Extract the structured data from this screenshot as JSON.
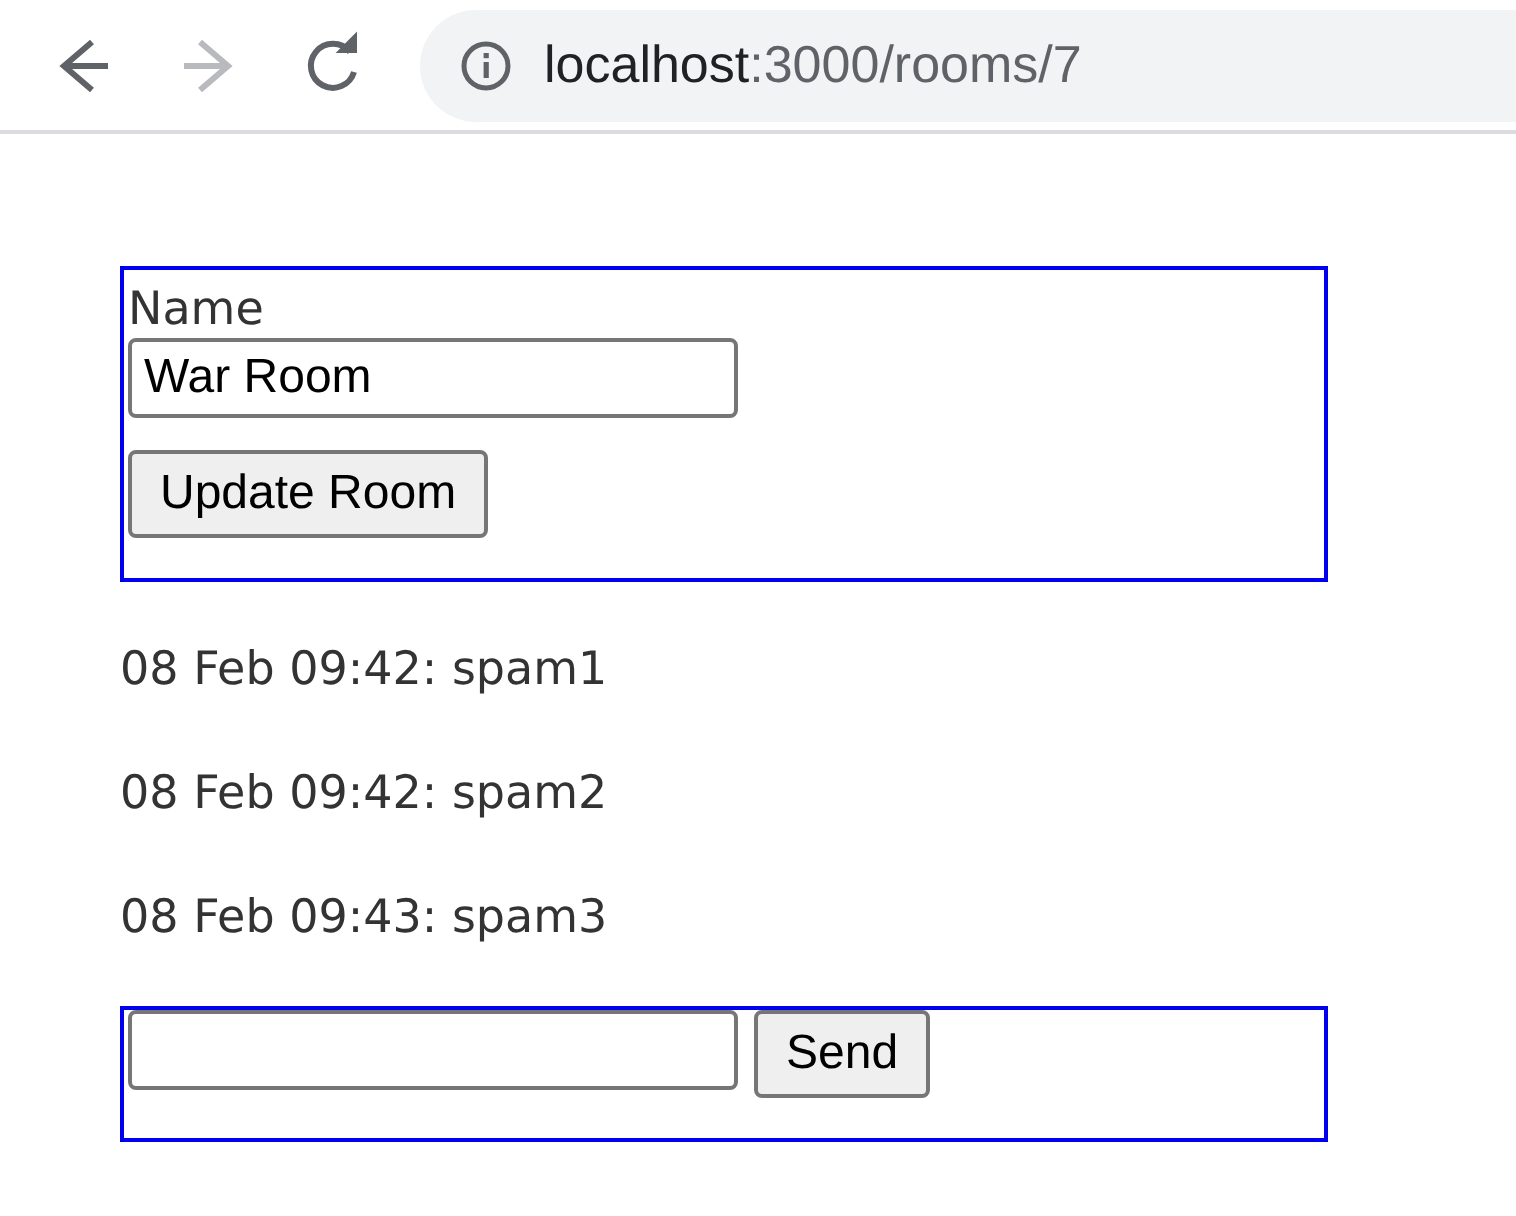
{
  "browser": {
    "nav": [
      {
        "kind": "back",
        "disabled": false
      },
      {
        "kind": "forward",
        "disabled": true
      },
      {
        "kind": "reload",
        "disabled": false
      }
    ],
    "url_host": "localhost",
    "url_path": ":3000/rooms/7"
  },
  "room_form": {
    "label": "Name",
    "value": "War Room",
    "button": "Update Room"
  },
  "messages": [
    "08 Feb 09:42: spam1",
    "08 Feb 09:42: spam2",
    "08 Feb 09:43: spam3"
  ],
  "message_form": {
    "button": "Send"
  }
}
